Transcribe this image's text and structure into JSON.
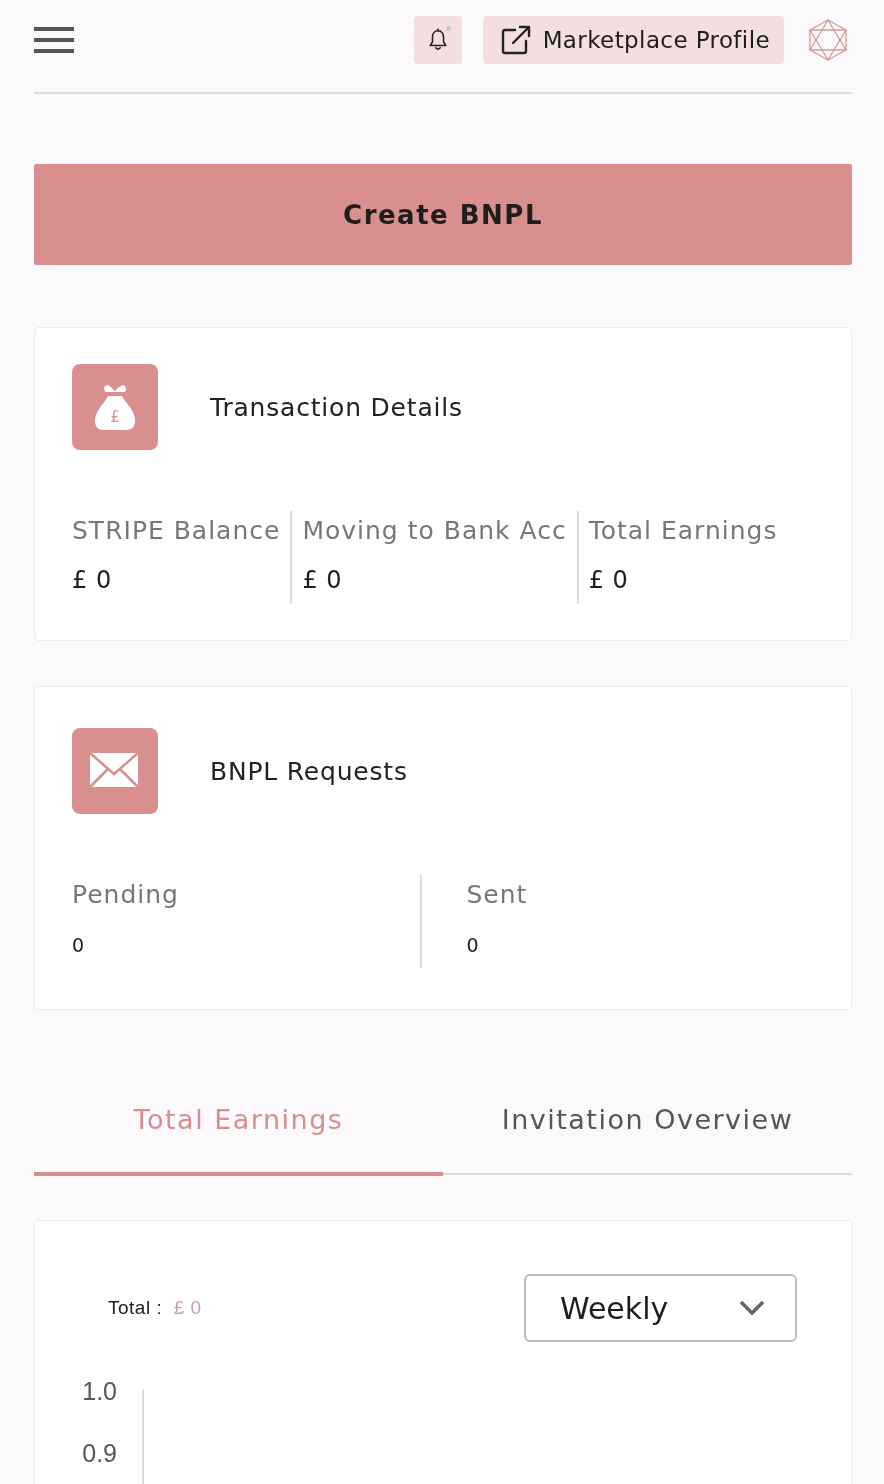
{
  "header": {
    "notifications": {
      "unread": true
    },
    "marketplace_button": {
      "label": "Marketplace Profile"
    }
  },
  "create_button": {
    "label": "Create BNPL"
  },
  "cards": [
    {
      "kind": "money",
      "icon_symbol": "£",
      "title": "Transaction Details",
      "stats": [
        {
          "label": "STRIPE Balance",
          "value": "£ 0"
        },
        {
          "label": "Moving to Bank Acc",
          "value": "£ 0"
        },
        {
          "label": "Total Earnings",
          "value": "£ 0"
        }
      ]
    },
    {
      "kind": "mail",
      "title": "BNPL Requests",
      "stats": [
        {
          "label": "Pending",
          "value": "0"
        },
        {
          "label": "Sent",
          "value": "0"
        }
      ]
    }
  ],
  "tabs": [
    {
      "label": "Total Earnings",
      "selected": true
    },
    {
      "label": "Invitation Overview",
      "selected": false
    }
  ],
  "earnings_panel": {
    "total_label": "Total :",
    "total_value": "£ 0",
    "period_select": {
      "value": "Weekly"
    },
    "axis_labels": [
      "1.0",
      "0.9"
    ]
  }
}
